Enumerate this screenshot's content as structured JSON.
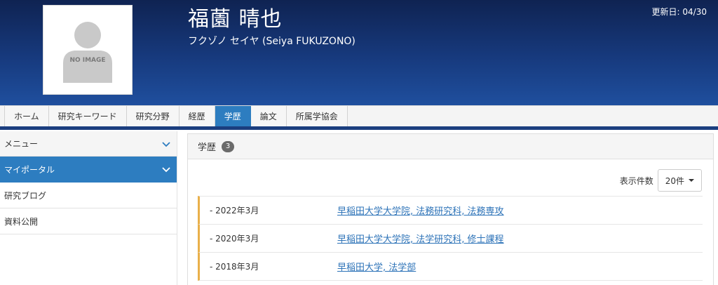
{
  "header": {
    "name": "福薗 晴也",
    "kana": "フクゾノ セイヤ  (Seiya FUKUZONO)",
    "updated": "更新日: 04/30",
    "photo_text": "NO IMAGE"
  },
  "tabs": [
    {
      "label": "ホーム"
    },
    {
      "label": "研究キーワード"
    },
    {
      "label": "研究分野"
    },
    {
      "label": "経歴"
    },
    {
      "label": "学歴"
    },
    {
      "label": "論文"
    },
    {
      "label": "所属学協会"
    }
  ],
  "sidebar": {
    "menu_label": "メニュー",
    "items": [
      {
        "label": "マイポータル"
      },
      {
        "label": "研究ブログ"
      },
      {
        "label": "資料公開"
      }
    ]
  },
  "main": {
    "title": "学歴",
    "count": "3",
    "display_count_label": "表示件数",
    "display_count_value": "20件",
    "rows": [
      {
        "date": "- 2022年3月",
        "institution": "早稲田大学大学院, 法務研究科, 法務専攻"
      },
      {
        "date": "- 2020年3月",
        "institution": "早稲田大学大学院, 法学研究科, 修士課程"
      },
      {
        "date": "- 2018年3月",
        "institution": "早稲田大学, 法学部"
      }
    ]
  },
  "colors": {
    "header_bg": "#173a7e",
    "accent": "#2d7dc0",
    "row_marker": "#e9b04a"
  }
}
